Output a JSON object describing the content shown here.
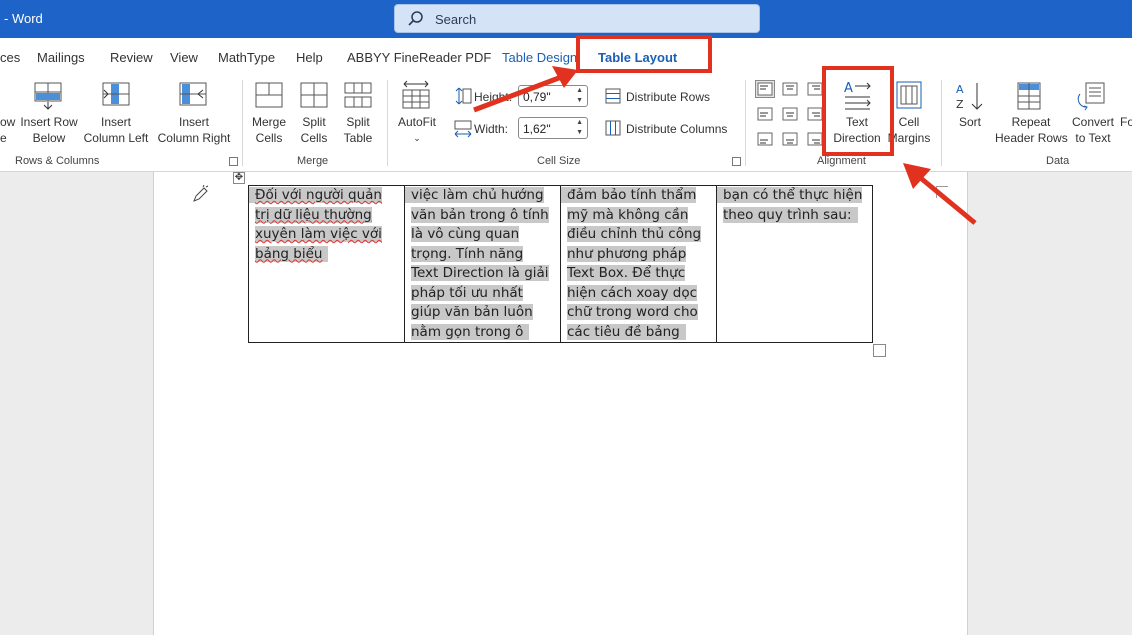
{
  "titlebar": {
    "app_title": "- Word",
    "search_placeholder": "Search"
  },
  "tabs": [
    {
      "label": "ces"
    },
    {
      "label": "Mailings"
    },
    {
      "label": "Review"
    },
    {
      "label": "View"
    },
    {
      "label": "MathType"
    },
    {
      "label": "Help"
    },
    {
      "label": "ABBYY FineReader PDF"
    },
    {
      "label": "Table Design"
    },
    {
      "label": "Table Layout"
    }
  ],
  "ribbon": {
    "rows_columns": {
      "insert_row_above_partial": [
        "ow",
        "e"
      ],
      "insert_row_below": [
        "Insert Row",
        "Below"
      ],
      "insert_column_left": [
        "Insert",
        "Column Left"
      ],
      "insert_column_right": [
        "Insert",
        "Column Right"
      ],
      "group_label": "Rows & Columns"
    },
    "merge": {
      "merge_cells": [
        "Merge",
        "Cells"
      ],
      "split_cells": [
        "Split",
        "Cells"
      ],
      "split_table": [
        "Split",
        "Table"
      ],
      "group_label": "Merge"
    },
    "cell_size": {
      "autofit": "AutoFit",
      "height_label": "Height:",
      "height_value": "0,79\"",
      "width_label": "Width:",
      "width_value": "1,62\"",
      "distribute_rows": "Distribute Rows",
      "distribute_columns": "Distribute Columns",
      "group_label": "Cell Size"
    },
    "alignment": {
      "text_direction": [
        "Text",
        "Direction"
      ],
      "cell_margins": [
        "Cell",
        "Margins"
      ],
      "group_label": "Alignment"
    },
    "data": {
      "sort": "Sort",
      "repeat_header_rows": [
        "Repeat",
        "Header Rows"
      ],
      "convert_to_text": [
        "Convert",
        "to Text"
      ],
      "formula_partial": "Fo",
      "group_label": "Data"
    }
  },
  "document": {
    "cells": [
      "Đối với người quản trị dữ liệu thường xuyên làm việc với bảng biểu",
      "việc làm chủ hướng văn bản trong ô tính là vô cùng quan trọng. Tính năng Text Direction là giải pháp tối ưu nhất giúp văn bản luôn nằm gọn trong ô",
      "đảm bảo tính thẩm mỹ mà không cần điều chỉnh thủ công như phương pháp Text Box. Để thực hiện cách xoay dọc chữ trong word cho các tiêu đề bảng",
      "bạn có thể thực hiện theo quy trình sau:"
    ]
  },
  "colors": {
    "titlebar": "#1e64c8",
    "accent": "#1a5fb4",
    "annotation": "#e0321f"
  }
}
